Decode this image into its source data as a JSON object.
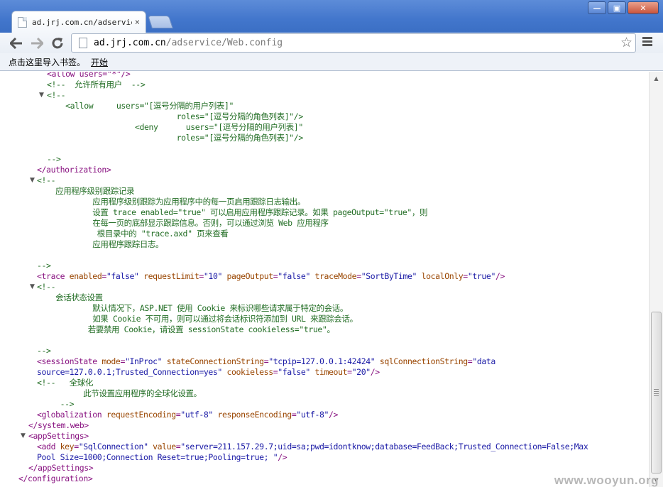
{
  "browser": {
    "tab_title": "ad.jrj.com.cn/adservice",
    "close_glyph": "×",
    "url_host": "ad.jrj.com.cn",
    "url_path": "/adservice/Web.config",
    "bookmark_prompt": "点击这里导入书签。",
    "bookmark_start": "开始",
    "window_minimize": "—",
    "window_restore": "▣",
    "window_close": "✕"
  },
  "xml_lines": [
    {
      "toggle": "",
      "spans": [
        {
          "c": "t",
          "x": "<allow users=\"*\"/>"
        }
      ]
    },
    {
      "toggle": "",
      "spans": [
        {
          "c": "cm",
          "x": "<!--  允许所有用户  -->"
        }
      ]
    },
    {
      "toggle": "▼",
      "spans": [
        {
          "c": "cm",
          "x": "<!--"
        }
      ]
    },
    {
      "toggle": "",
      "spans": [
        {
          "c": "cm",
          "x": "    <allow     users=\"[逗号分隔的用户列表]\""
        }
      ]
    },
    {
      "toggle": "",
      "spans": [
        {
          "c": "cm",
          "x": "                            roles=\"[逗号分隔的角色列表]\"/>"
        }
      ]
    },
    {
      "toggle": "",
      "spans": [
        {
          "c": "cm",
          "x": "                   <deny      users=\"[逗号分隔的用户列表]\""
        }
      ]
    },
    {
      "toggle": "",
      "spans": [
        {
          "c": "cm",
          "x": "                            roles=\"[逗号分隔的角色列表]\"/>"
        }
      ]
    },
    {
      "toggle": "",
      "spans": []
    },
    {
      "toggle": "",
      "spans": [
        {
          "c": "cm",
          "x": "-->"
        }
      ]
    },
    {
      "toggle": "",
      "spans": [
        {
          "c": "t",
          "x": "</authorization>"
        }
      ]
    },
    {
      "toggle": "▼",
      "spans": [
        {
          "c": "cm",
          "x": "<!--"
        }
      ]
    },
    {
      "toggle": "",
      "spans": [
        {
          "c": "cm",
          "x": "    应用程序级别跟踪记录"
        }
      ]
    },
    {
      "toggle": "",
      "spans": [
        {
          "c": "cm",
          "x": "            应用程序级别跟踪为应用程序中的每一页启用跟踪日志输出。"
        }
      ]
    },
    {
      "toggle": "",
      "spans": [
        {
          "c": "cm",
          "x": "            设置 trace enabled=\"true\" 可以启用应用程序跟踪记录。如果 pageOutput=\"true\"，则"
        }
      ]
    },
    {
      "toggle": "",
      "spans": [
        {
          "c": "cm",
          "x": "            在每一页的底部显示跟踪信息。否则，可以通过浏览 Web 应用程序"
        }
      ]
    },
    {
      "toggle": "",
      "spans": [
        {
          "c": "cm",
          "x": "             根目录中的 \"trace.axd\" 页来查看"
        }
      ]
    },
    {
      "toggle": "",
      "spans": [
        {
          "c": "cm",
          "x": "            应用程序跟踪日志。"
        }
      ]
    },
    {
      "toggle": "",
      "spans": []
    },
    {
      "toggle": "",
      "spans": [
        {
          "c": "cm",
          "x": "-->"
        }
      ]
    },
    {
      "toggle": "",
      "spans": [
        {
          "c": "t",
          "x": "<trace "
        },
        {
          "c": "an",
          "x": "enabled"
        },
        {
          "c": "t",
          "x": "="
        },
        {
          "c": "av",
          "x": "\"false\""
        },
        {
          "c": "an",
          "x": " requestLimit"
        },
        {
          "c": "t",
          "x": "="
        },
        {
          "c": "av",
          "x": "\"10\""
        },
        {
          "c": "an",
          "x": " pageOutput"
        },
        {
          "c": "t",
          "x": "="
        },
        {
          "c": "av",
          "x": "\"false\""
        },
        {
          "c": "an",
          "x": " traceMode"
        },
        {
          "c": "t",
          "x": "="
        },
        {
          "c": "av",
          "x": "\"SortByTime\""
        },
        {
          "c": "an",
          "x": " localOnly"
        },
        {
          "c": "t",
          "x": "="
        },
        {
          "c": "av",
          "x": "\"true\""
        },
        {
          "c": "t",
          "x": "/>"
        }
      ]
    },
    {
      "toggle": "▼",
      "spans": [
        {
          "c": "cm",
          "x": "<!--"
        }
      ]
    },
    {
      "toggle": "",
      "spans": [
        {
          "c": "cm",
          "x": "    会话状态设置"
        }
      ]
    },
    {
      "toggle": "",
      "spans": [
        {
          "c": "cm",
          "x": "            默认情况下，ASP.NET 使用 Cookie 来标识哪些请求属于特定的会话。"
        }
      ]
    },
    {
      "toggle": "",
      "spans": [
        {
          "c": "cm",
          "x": "            如果 Cookie 不可用，则可以通过将会话标识符添加到 URL 来跟踪会话。"
        }
      ]
    },
    {
      "toggle": "",
      "spans": [
        {
          "c": "cm",
          "x": "           若要禁用 Cookie，请设置 sessionState cookieless=\"true\"。"
        }
      ]
    },
    {
      "toggle": "",
      "spans": []
    },
    {
      "toggle": "",
      "spans": [
        {
          "c": "cm",
          "x": "-->"
        }
      ]
    },
    {
      "toggle": "",
      "spans": [
        {
          "c": "t",
          "x": "<sessionState "
        },
        {
          "c": "an",
          "x": "mode"
        },
        {
          "c": "t",
          "x": "="
        },
        {
          "c": "av",
          "x": "\"InProc\""
        },
        {
          "c": "an",
          "x": " stateConnectionString"
        },
        {
          "c": "t",
          "x": "="
        },
        {
          "c": "av",
          "x": "\"tcpip=127.0.0.1:42424\""
        },
        {
          "c": "an",
          "x": " sqlConnectionString"
        },
        {
          "c": "t",
          "x": "="
        },
        {
          "c": "av",
          "x": "\"data"
        }
      ]
    },
    {
      "toggle": "",
      "spans": [
        {
          "c": "av",
          "x": "source=127.0.0.1;Trusted_Connection=yes\""
        },
        {
          "c": "an",
          "x": " cookieless"
        },
        {
          "c": "t",
          "x": "="
        },
        {
          "c": "av",
          "x": "\"false\""
        },
        {
          "c": "an",
          "x": " timeout"
        },
        {
          "c": "t",
          "x": "="
        },
        {
          "c": "av",
          "x": "\"20\""
        },
        {
          "c": "t",
          "x": "/>"
        }
      ]
    },
    {
      "toggle": "",
      "spans": [
        {
          "c": "cm",
          "x": "<!--   全球化"
        }
      ]
    },
    {
      "toggle": "",
      "spans": [
        {
          "c": "cm",
          "x": "          此节设置应用程序的全球化设置。"
        }
      ]
    },
    {
      "toggle": "",
      "spans": [
        {
          "c": "cm",
          "x": "     -->"
        }
      ]
    },
    {
      "toggle": "",
      "spans": [
        {
          "c": "t",
          "x": "<globalization "
        },
        {
          "c": "an",
          "x": "requestEncoding"
        },
        {
          "c": "t",
          "x": "="
        },
        {
          "c": "av",
          "x": "\"utf-8\""
        },
        {
          "c": "an",
          "x": " responseEncoding"
        },
        {
          "c": "t",
          "x": "="
        },
        {
          "c": "av",
          "x": "\"utf-8\""
        },
        {
          "c": "t",
          "x": "/>"
        }
      ]
    },
    {
      "toggle": "",
      "spans": [
        {
          "c": "t",
          "x": "</system.web>"
        }
      ]
    },
    {
      "toggle": "▼",
      "spans": [
        {
          "c": "t",
          "x": "<appSettings>"
        }
      ]
    },
    {
      "toggle": "",
      "spans": [
        {
          "c": "t",
          "x": "<add "
        },
        {
          "c": "an",
          "x": "key"
        },
        {
          "c": "t",
          "x": "="
        },
        {
          "c": "av",
          "x": "\"SqlConnection\""
        },
        {
          "c": "an",
          "x": " value"
        },
        {
          "c": "t",
          "x": "="
        },
        {
          "c": "av",
          "x": "\"server=211.157.29.7;uid=sa;pwd=idontknow;database=FeedBack;Trusted_Connection=False;Max"
        }
      ]
    },
    {
      "toggle": "",
      "spans": [
        {
          "c": "av",
          "x": "Pool Size=1000;Connection Reset=true;Pooling=true; \""
        },
        {
          "c": "t",
          "x": "/>"
        }
      ]
    },
    {
      "toggle": "",
      "spans": [
        {
          "c": "t",
          "x": "</appSettings>"
        }
      ]
    },
    {
      "toggle": "",
      "spans": [
        {
          "c": "t",
          "x": "</configuration>"
        }
      ]
    }
  ],
  "watermark": "www.wooyun.org"
}
